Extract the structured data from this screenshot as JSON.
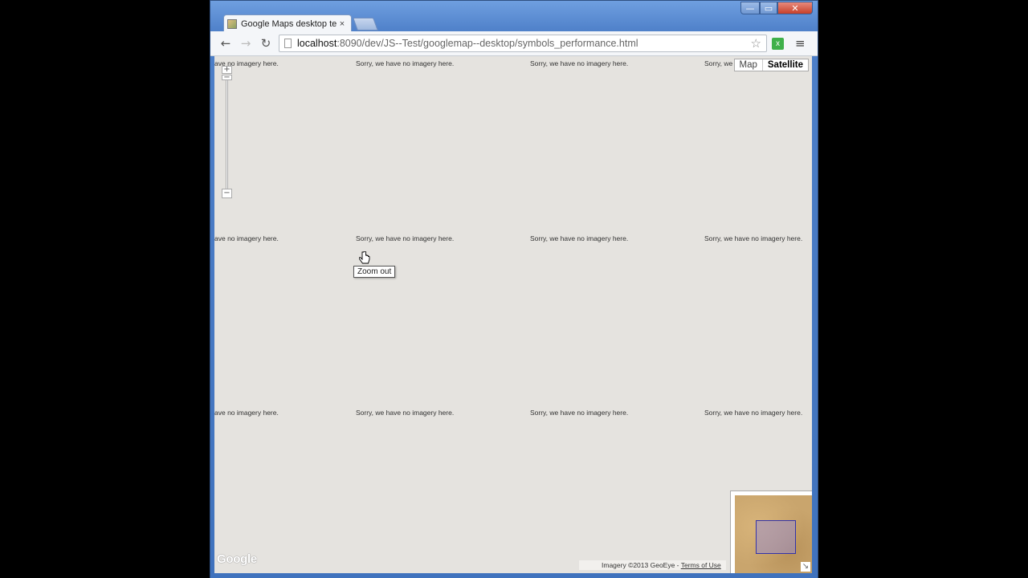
{
  "browser": {
    "tab_title": "Google Maps desktop test",
    "tab_close": "×",
    "url_host": "localhost",
    "url_rest": ":8090/dev/JS--Test/googlemap--desktop/symbols_performance.html",
    "window": {
      "minimize": "—",
      "maximize": "▭",
      "close": "✕"
    },
    "nav": {
      "back": "←",
      "forward": "→",
      "reload": "↻",
      "star": "☆",
      "menu": "≡",
      "extension": "x"
    }
  },
  "map": {
    "no_imagery_text": "Sorry, we have no imagery here.",
    "no_imagery_partial": "ave no imagery here.",
    "maptype": {
      "map_label": "Map",
      "satellite_label": "Satellite",
      "selected": "Satellite"
    },
    "zoom": {
      "in": "+",
      "out": "−",
      "handle": "−"
    },
    "tooltip": "Zoom out",
    "logo": "Google",
    "attribution_text": "Imagery ©2013 GeoEye - ",
    "terms_link": "Terms of Use",
    "overview_toggle": "↘"
  }
}
